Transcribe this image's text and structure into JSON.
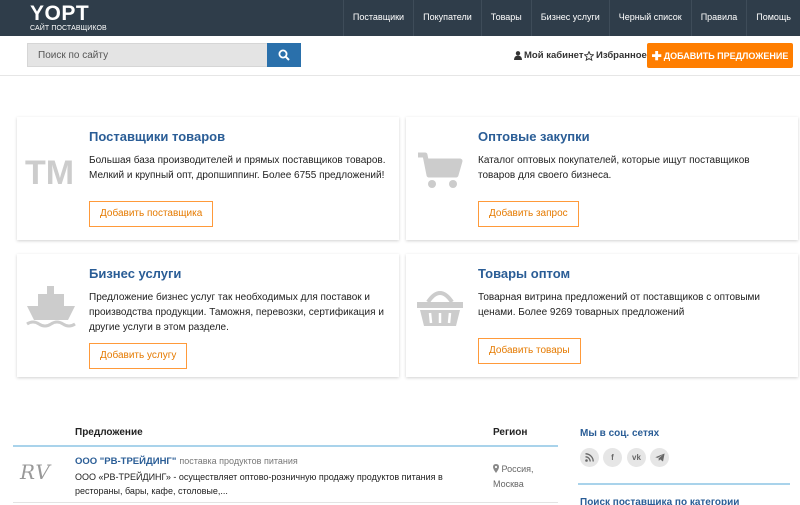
{
  "logo": {
    "main": "YOPT",
    "sub": "САЙТ ПОСТАВЩИКОВ"
  },
  "nav": [
    "Поставщики",
    "Покупатели",
    "Товары",
    "Бизнес услуги",
    "Черный список",
    "Правила",
    "Помощь"
  ],
  "search": {
    "placeholder": "Поиск по сайту"
  },
  "account": {
    "cabinet": "Мой кабинет",
    "favorites": "Избранное"
  },
  "add_offer": "ДОБАВИТЬ ПРЕДЛОЖЕНИЕ",
  "cards": [
    {
      "icon": "tm-icon",
      "title": "Поставщики товаров",
      "desc": "Большая база производителей и прямых поставщиков товаров. Мелкий и крупный опт, дропшиппинг. Более 6755 предложений!",
      "button": "Добавить поставщика"
    },
    {
      "icon": "shopping-cart-icon",
      "title": "Оптовые закупки",
      "desc": "Каталог оптовых покупателей, которые ищут поставщиков товаров для своего бизнеса.",
      "button": "Добавить запрос"
    },
    {
      "icon": "ship-icon",
      "title": "Бизнес услуги",
      "desc": "Предложение бизнес услуг так необходимых для поставок и производства продукции. Таможня, перевозки, сертификация и другие услуги в этом разделе.",
      "button": "Добавить услугу"
    },
    {
      "icon": "basket-icon",
      "title": "Товары оптом",
      "desc": "Товарная витрина предложений от поставщиков с оптовыми ценами. Более 9269 товарных предложений",
      "button": "Добавить товары"
    }
  ],
  "table": {
    "col_offer": "Предложение",
    "col_region": "Регион",
    "rows": [
      {
        "logo_text": "RV",
        "company": "ООО \"РВ-ТРЕЙДИНГ\"",
        "category": "поставка продуктов питания",
        "desc": "ООО «РВ-ТРЕЙДИНГ» - осуществляет оптово-розничную продажу продуктов питания в рестораны, бары, кафе, столовые,...",
        "region_country": "Россия,",
        "region_city": "Москва"
      }
    ]
  },
  "sidebar": {
    "social_title": "Мы в соц. сетях",
    "social_icons": [
      "rss-icon",
      "facebook-icon",
      "vk-icon",
      "telegram-icon"
    ],
    "category_title": "Поиск поставщика по категории"
  },
  "colors": {
    "nav_bg": "#2f3d4a",
    "accent": "#ff7e00",
    "link": "#2a5d96",
    "search_btn": "#2a70ab"
  }
}
